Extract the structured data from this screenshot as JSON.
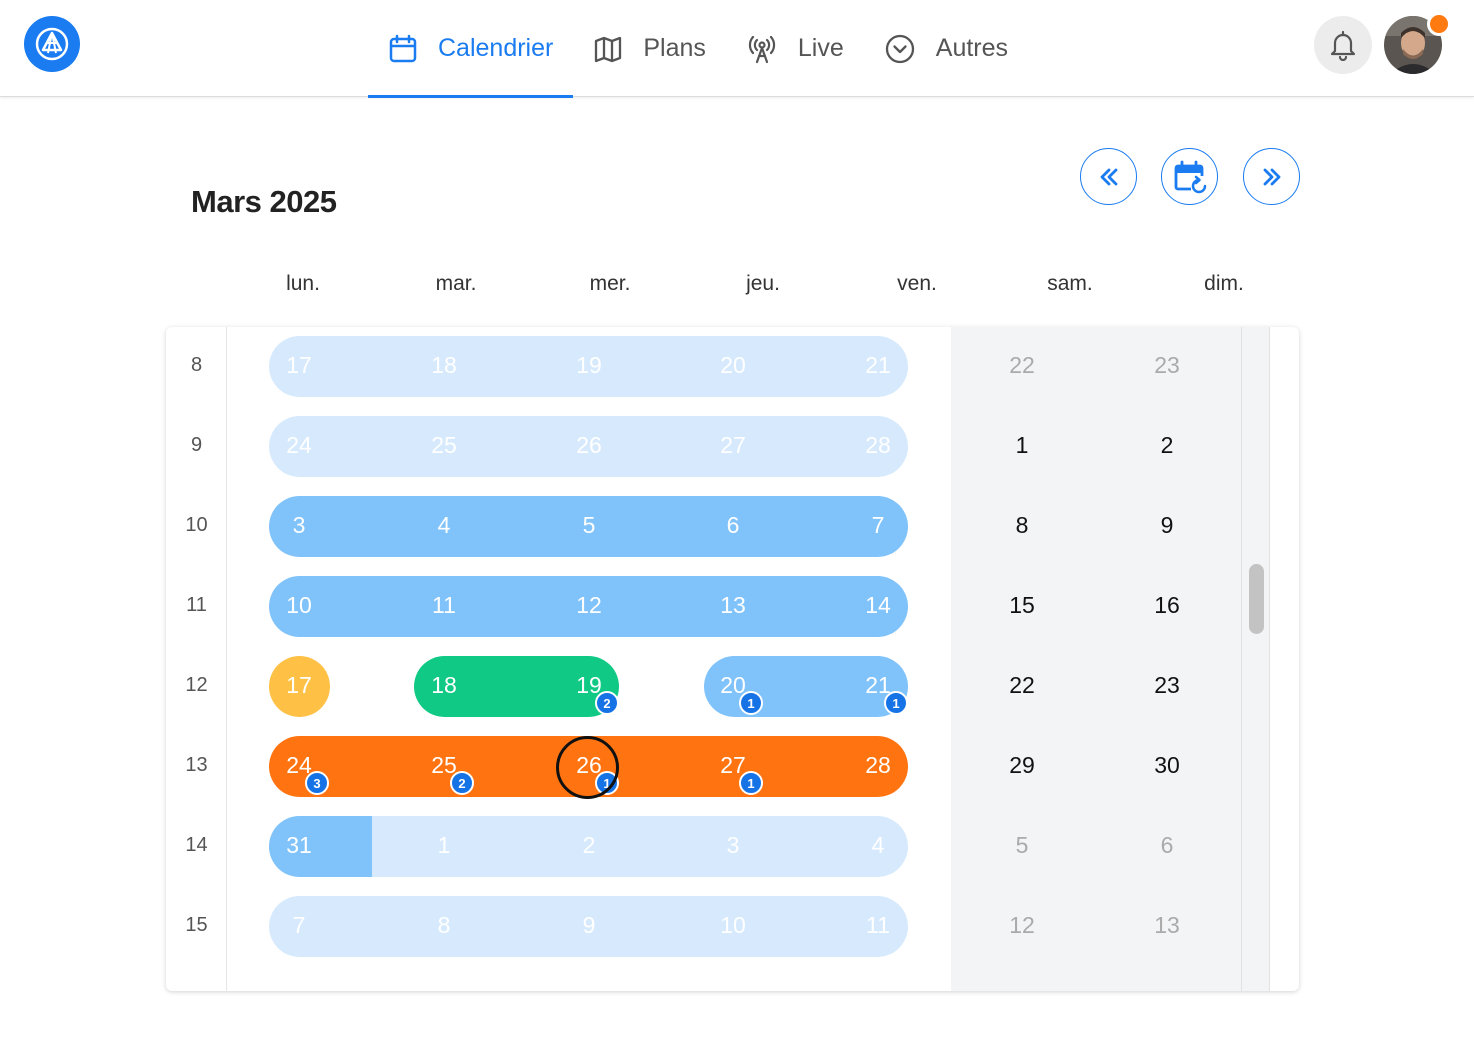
{
  "nav": {
    "items": [
      {
        "label": "Calendrier",
        "icon": "calendar-icon",
        "active": true
      },
      {
        "label": "Plans",
        "icon": "map-icon"
      },
      {
        "label": "Live",
        "icon": "broadcast-icon"
      },
      {
        "label": "Autres",
        "icon": "chevron-circle-icon"
      }
    ]
  },
  "calendar": {
    "month_title": "Mars 2025",
    "weekdays": [
      "lun.",
      "mar.",
      "mer.",
      "jeu.",
      "ven.",
      "sam.",
      "dim."
    ],
    "weeks": [
      {
        "num": "8",
        "days": [
          "17",
          "18",
          "19",
          "20",
          "21",
          "22",
          "23"
        ]
      },
      {
        "num": "9",
        "days": [
          "24",
          "25",
          "26",
          "27",
          "28",
          "1",
          "2"
        ]
      },
      {
        "num": "10",
        "days": [
          "3",
          "4",
          "5",
          "6",
          "7",
          "8",
          "9"
        ]
      },
      {
        "num": "11",
        "days": [
          "10",
          "11",
          "12",
          "13",
          "14",
          "15",
          "16"
        ]
      },
      {
        "num": "12",
        "days": [
          "17",
          "18",
          "19",
          "20",
          "21",
          "22",
          "23"
        ]
      },
      {
        "num": "13",
        "days": [
          "24",
          "25",
          "26",
          "27",
          "28",
          "29",
          "30"
        ]
      },
      {
        "num": "14",
        "days": [
          "31",
          "1",
          "2",
          "3",
          "4",
          "5",
          "6"
        ]
      },
      {
        "num": "15",
        "days": [
          "7",
          "8",
          "9",
          "10",
          "11",
          "12",
          "13"
        ]
      }
    ],
    "badges": {
      "w12_mer": "2",
      "w12_jeu": "1",
      "w12_ven": "1",
      "w13_lun": "3",
      "w13_mar": "2",
      "w13_mer": "1",
      "w13_jeu": "1"
    },
    "colors": {
      "accent": "#1a7cf0",
      "light_blue": "#d7eafd",
      "blue": "#80c2fa",
      "green": "#10c985",
      "yellow": "#ffc145",
      "orange": "#ff7410"
    }
  }
}
